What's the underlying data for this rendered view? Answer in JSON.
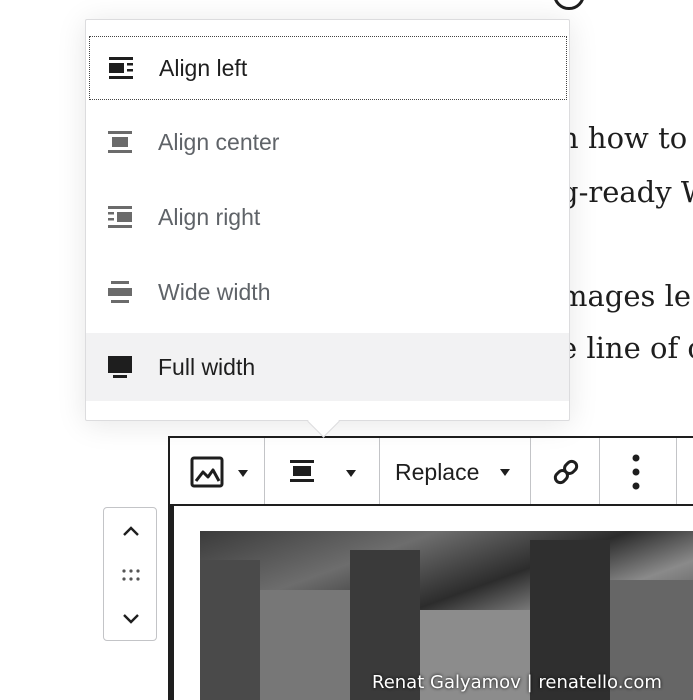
{
  "background_text": {
    "line1": "n how to",
    "line2": "g-ready W",
    "line3": "mages le",
    "line4": "e line of c",
    "line5": "."
  },
  "align_menu": {
    "items": [
      {
        "label": "Align left",
        "icon": "align-left-icon"
      },
      {
        "label": "Align center",
        "icon": "align-center-icon"
      },
      {
        "label": "Align right",
        "icon": "align-right-icon"
      },
      {
        "label": "Wide width",
        "icon": "wide-width-icon"
      },
      {
        "label": "Full width",
        "icon": "full-width-icon"
      }
    ]
  },
  "toolbar": {
    "replace_label": "Replace"
  },
  "image": {
    "credit": "Renat Galyamov | renatello.com"
  },
  "colors": {
    "text": "#1e1e1e",
    "muted": "#5f6368",
    "hover_bg": "#f2f2f3",
    "border": "#c3c4c7"
  }
}
